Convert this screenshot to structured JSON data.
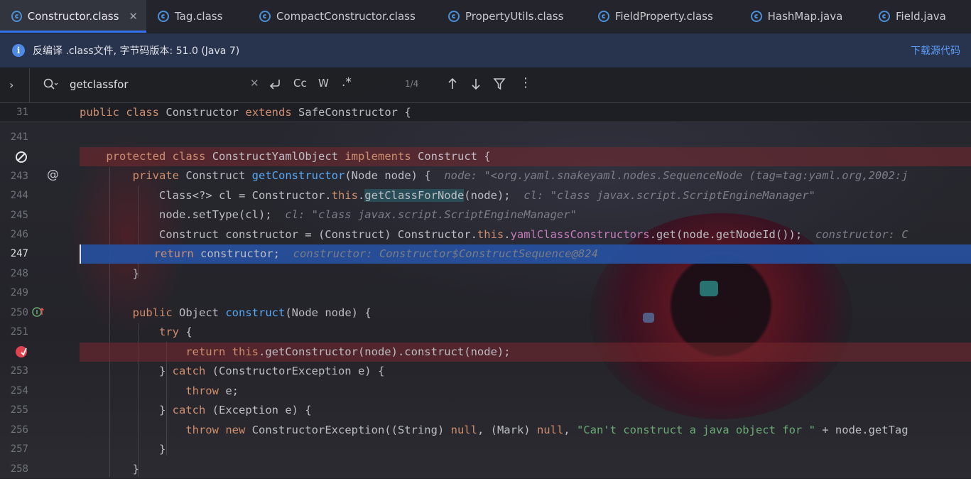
{
  "tabs": [
    {
      "label": "Constructor.class",
      "active": true
    },
    {
      "label": "Tag.class"
    },
    {
      "label": "CompactConstructor.class"
    },
    {
      "label": "PropertyUtils.class"
    },
    {
      "label": "FieldProperty.class"
    },
    {
      "label": "HashMap.java"
    },
    {
      "label": "Field.java"
    }
  ],
  "infobar": {
    "message": "反编译 .class文件, 字节码版本: 51.0 (Java 7)",
    "download_link": "下载源代码"
  },
  "search": {
    "query": "getclassfor",
    "case_label": "Cc",
    "word_label": "W",
    "regex_label": ".*",
    "match_count": "1/4"
  },
  "sticky": {
    "line_number": "31",
    "code": {
      "kw1": "public",
      "kw2": "class",
      "name": "Constructor",
      "kw3": "extends",
      "parent": "SafeConstructor",
      "brace": "{"
    }
  },
  "line_numbers": [
    "241",
    "",
    "243",
    "244",
    "245",
    "246",
    "247",
    "248",
    "249",
    "250",
    "251",
    "",
    "253",
    "254",
    "255",
    "256",
    "257",
    "258"
  ],
  "code": {
    "l242": {
      "kw1": "protected",
      "kw2": "class",
      "name": "ConstructYamlObject",
      "kw3": "implements",
      "iface": "Construct",
      "brace": "{"
    },
    "l243": {
      "kw": "private",
      "type": "Construct",
      "fn": "getConstructor",
      "params": "(Node node) {",
      "hint": "node: \"<org.yaml.snakeyaml.nodes.SequenceNode (tag=tag:yaml.org,2002:j"
    },
    "l244": {
      "a": "Class<?> cl = Constructor.",
      "this": "this",
      "dot": ".",
      "match": "getClassForNode",
      "b": "(node);",
      "hint": "cl: \"class javax.script.ScriptEngineManager\""
    },
    "l245": {
      "a": "node.setType(cl);",
      "hint": "cl: \"class javax.script.ScriptEngineManager\""
    },
    "l246": {
      "a": "Construct constructor = (Construct) Constructor.",
      "this": "this",
      "dot": ".",
      "field": "yamlClassConstructors",
      "b": ".get(node.getNodeId());",
      "hint": "constructor: C"
    },
    "l247": {
      "kw": "return",
      "a": "constructor;",
      "hint": "constructor: Constructor$ConstructSequence@824"
    },
    "l248": {
      "a": "}"
    },
    "l250": {
      "kw": "public",
      "type": "Object",
      "fn": "construct",
      "params": "(Node node) {"
    },
    "l251": {
      "kw": "try",
      "a": "{"
    },
    "l252": {
      "kw": "return",
      "this": "this",
      "a": ".getConstructor(node).construct(node);"
    },
    "l253": {
      "a": "} ",
      "kw": "catch",
      "b": "(ConstructorException e) {"
    },
    "l254": {
      "kw": "throw",
      "a": "e;"
    },
    "l255": {
      "a": "} ",
      "kw": "catch",
      "b": "(Exception e) {"
    },
    "l256": {
      "kw1": "throw",
      "kw2": "new",
      "a": "ConstructorException((String) ",
      "null1": "null",
      "b": ", (Mark) ",
      "null2": "null",
      "c": ", ",
      "str": "\"Can't construct a java object for \"",
      "d": " + node.getTag"
    },
    "l257": {
      "a": "}"
    },
    "l258": {
      "a": "}"
    }
  },
  "colors": {
    "accent": "#3574f0",
    "keyword": "#cf8e6d",
    "function": "#56a8f5",
    "field": "#c77dbb",
    "string": "#6aab73",
    "breakpoint_row": "#782d2d",
    "current_row": "#2650a0"
  },
  "icons": {
    "tab": "class-file-icon",
    "info": "info-icon",
    "gutter_242": "breakpoint-disabled-icon",
    "gutter_243": "annotation-at-icon",
    "gutter_250": "implements-method-icon",
    "gutter_252": "breakpoint-icon"
  }
}
